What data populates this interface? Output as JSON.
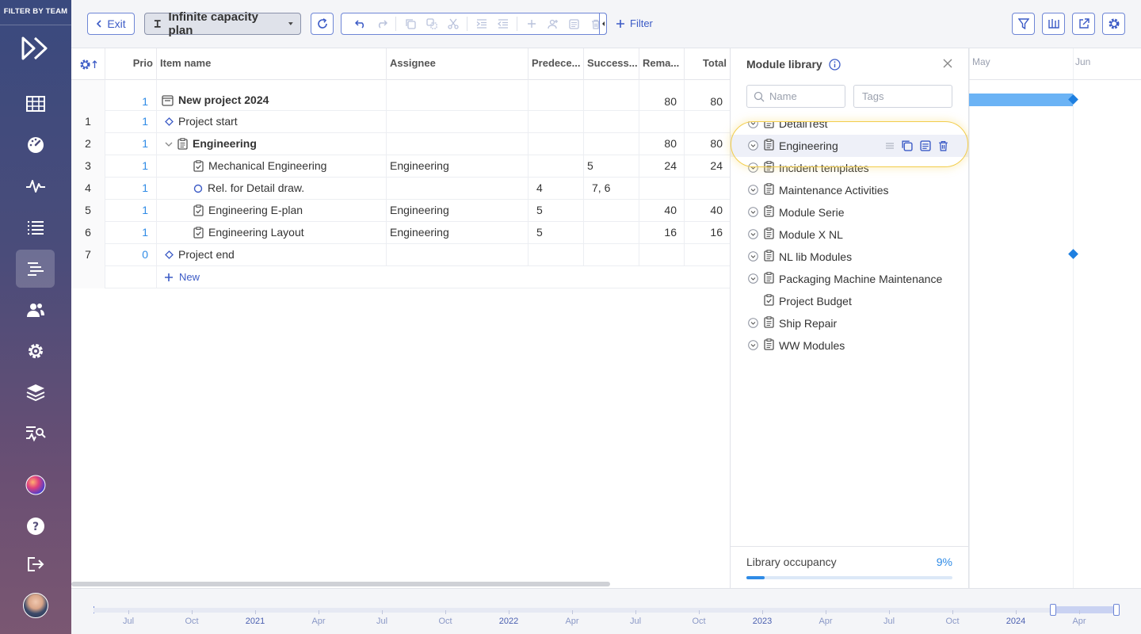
{
  "sidebar": {
    "filter_label": "FILTER BY TEAM",
    "items": [
      {
        "icon": "table-icon"
      },
      {
        "icon": "dashboard-gauge-icon"
      },
      {
        "icon": "activity-pulse-icon"
      },
      {
        "icon": "list-icon"
      },
      {
        "icon": "gantt-list-icon",
        "active": true
      },
      {
        "icon": "users-icon"
      },
      {
        "icon": "gear-icon"
      },
      {
        "icon": "layers-icon"
      },
      {
        "icon": "analytics-icon"
      },
      {
        "icon": "gradient-orb-icon"
      },
      {
        "icon": "help-icon"
      },
      {
        "icon": "logout-icon"
      }
    ]
  },
  "toolbar": {
    "exit_label": "Exit",
    "plan_label": "Infinite capacity plan",
    "filter_label": "Filter"
  },
  "grid": {
    "columns": {
      "prio": "Prio",
      "name": "Item name",
      "assignee": "Assignee",
      "predecessors": "Predece...",
      "successors": "Success...",
      "remaining": "Rema...",
      "total": "Total"
    },
    "rows": [
      {
        "idx": "",
        "prio": "1",
        "name": "New project 2024",
        "assignee": "",
        "pred": "",
        "succ": "",
        "rem": "80",
        "tot": "80"
      },
      {
        "idx": "1",
        "prio": "1",
        "name": "Project start",
        "assignee": "",
        "pred": "",
        "succ": "",
        "rem": "",
        "tot": ""
      },
      {
        "idx": "2",
        "prio": "1",
        "name": "Engineering",
        "assignee": "",
        "pred": "",
        "succ": "",
        "rem": "80",
        "tot": "80"
      },
      {
        "idx": "3",
        "prio": "1",
        "name": "Mechanical Engineering",
        "assignee": "Engineering",
        "pred": "",
        "succ": "5",
        "rem": "24",
        "tot": "24"
      },
      {
        "idx": "4",
        "prio": "1",
        "name": "Rel. for Detail draw.",
        "assignee": "",
        "pred": "4",
        "succ": "7, 6",
        "rem": "",
        "tot": ""
      },
      {
        "idx": "5",
        "prio": "1",
        "name": "Engineering E-plan",
        "assignee": "Engineering",
        "pred": "5",
        "succ": "",
        "rem": "40",
        "tot": "40"
      },
      {
        "idx": "6",
        "prio": "1",
        "name": "Engineering Layout",
        "assignee": "Engineering",
        "pred": "5",
        "succ": "",
        "rem": "16",
        "tot": "16"
      },
      {
        "idx": "7",
        "prio": "0",
        "name": "Project end",
        "assignee": "",
        "pred": "",
        "succ": "",
        "rem": "",
        "tot": ""
      }
    ],
    "new_label": "New"
  },
  "library": {
    "title": "Module library",
    "name_placeholder": "Name",
    "tags_placeholder": "Tags",
    "items": [
      "DetailTest",
      "Engineering",
      "Incident templates",
      "Maintenance Activities",
      "Module Serie",
      "Module X NL",
      "NL lib Modules",
      "Packaging Machine Maintenance",
      "Project Budget",
      "Ship Repair",
      "WW Modules"
    ],
    "occupancy_label": "Library occupancy",
    "occupancy_value": "9%",
    "occupancy_fraction": 0.09
  },
  "gantt": {
    "months": [
      "May",
      "Jun"
    ]
  },
  "timeline": {
    "labels": [
      "Jul",
      "Oct",
      "2021",
      "Apr",
      "Jul",
      "Oct",
      "2022",
      "Apr",
      "Jul",
      "Oct",
      "2023",
      "Apr",
      "Jul",
      "Oct",
      "2024",
      "Apr"
    ]
  }
}
